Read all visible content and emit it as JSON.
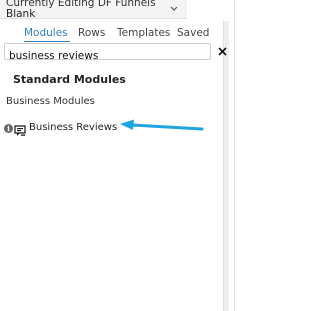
{
  "header": {
    "editing_line1": "Currently Editing DF Funnels",
    "editing_line2": "Blank",
    "dropdown_icon": "chevron-down-icon"
  },
  "tabs": [
    {
      "label": "Modules",
      "active": true
    },
    {
      "label": "Rows",
      "active": false
    },
    {
      "label": "Templates",
      "active": false
    },
    {
      "label": "Saved",
      "active": false
    }
  ],
  "search": {
    "value": "business reviews",
    "placeholder": "",
    "clear_icon": "close-icon"
  },
  "results": {
    "section_heading": "Standard Modules",
    "group_label": "Business Modules",
    "items": [
      {
        "label": "Business Reviews",
        "info_icon": "info-icon",
        "icon": "reviews-module-icon"
      }
    ]
  },
  "annotation": {
    "icon": "arrow-left-icon",
    "color": "#1fa4df"
  },
  "colors": {
    "accent": "#2f80c4",
    "arrow": "#1fa4df"
  }
}
